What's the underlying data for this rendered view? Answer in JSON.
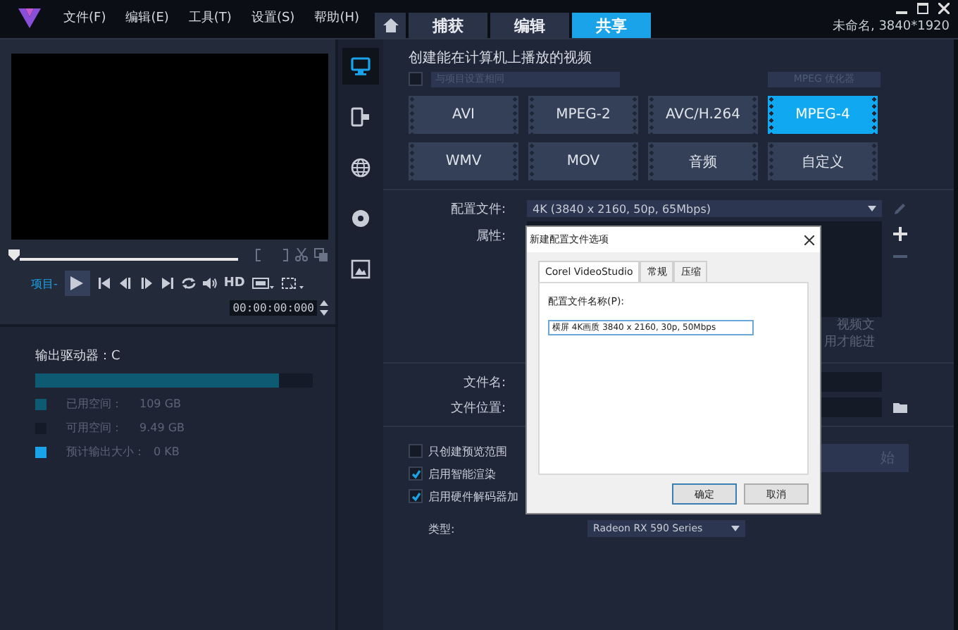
{
  "menu": [
    "文件(F)",
    "编辑(E)",
    "工具(T)",
    "设置(S)",
    "帮助(H)"
  ],
  "tabs": [
    {
      "label": "捕获",
      "selected": false
    },
    {
      "label": "编辑",
      "selected": false
    },
    {
      "label": "共享",
      "selected": true
    }
  ],
  "project_info": "未命名, 3840*1920",
  "player": {
    "mode_label": "项目-",
    "hd": "HD",
    "timecode": "00:00:00:000"
  },
  "output": {
    "drive_label": "输出驱动器：C",
    "level": 0.88,
    "legend": [
      {
        "label": "已用空间：",
        "value": "109 GB",
        "color": "#0e5a73"
      },
      {
        "label": "可用空间：",
        "value": "9.49 GB",
        "color": "#141a28"
      },
      {
        "label": "预计输出大小：",
        "value": "0 KB",
        "color": "#1aa3e8"
      }
    ]
  },
  "categories": [
    {
      "kind": "computer",
      "selected": true
    },
    {
      "kind": "device",
      "selected": false
    },
    {
      "kind": "web",
      "selected": false
    },
    {
      "kind": "disc",
      "selected": false
    },
    {
      "kind": "image",
      "selected": false
    }
  ],
  "share": {
    "heading": "创建能在计算机上播放的视频",
    "same_as_project": {
      "checked": false,
      "label": "与项目设置相同"
    },
    "optimizer": "MPEG 优化器",
    "formats": [
      {
        "label": "AVI",
        "selected": false
      },
      {
        "label": "MPEG-2",
        "selected": false
      },
      {
        "label": "AVC/H.264",
        "selected": false
      },
      {
        "label": "MPEG-4",
        "selected": true
      },
      {
        "label": "WMV",
        "selected": false
      },
      {
        "label": "MOV",
        "selected": false
      },
      {
        "label": "音频",
        "selected": false
      },
      {
        "label": "自定义",
        "selected": false
      }
    ],
    "profile_label": "配置文件:",
    "profile_value": "4K (3840 x 2160, 50p, 65Mbps)",
    "properties_label": "属性:",
    "properties_text": [
      "视频文",
      "用才能进"
    ],
    "filename_label": "文件名:",
    "location_label": "文件位置:",
    "options": [
      {
        "label": "只创建预览范围",
        "checked": false
      },
      {
        "label": "启用智能渲染",
        "checked": true
      },
      {
        "label": "启用硬件解码器加",
        "checked": true
      }
    ],
    "start_button": "始",
    "type_label": "类型:",
    "type_value": "Radeon RX 590 Series"
  },
  "dialog": {
    "title": "新建配置文件选项",
    "tabs": [
      {
        "label": "Corel VideoStudio",
        "selected": true
      },
      {
        "label": "常规",
        "selected": false
      },
      {
        "label": "压缩",
        "selected": false
      }
    ],
    "field_label": "配置文件名称(P):",
    "field_value": "横屏 4K画质 3840 x 2160, 30p, 50Mbps",
    "buttons": [
      "确定",
      "取消"
    ]
  }
}
